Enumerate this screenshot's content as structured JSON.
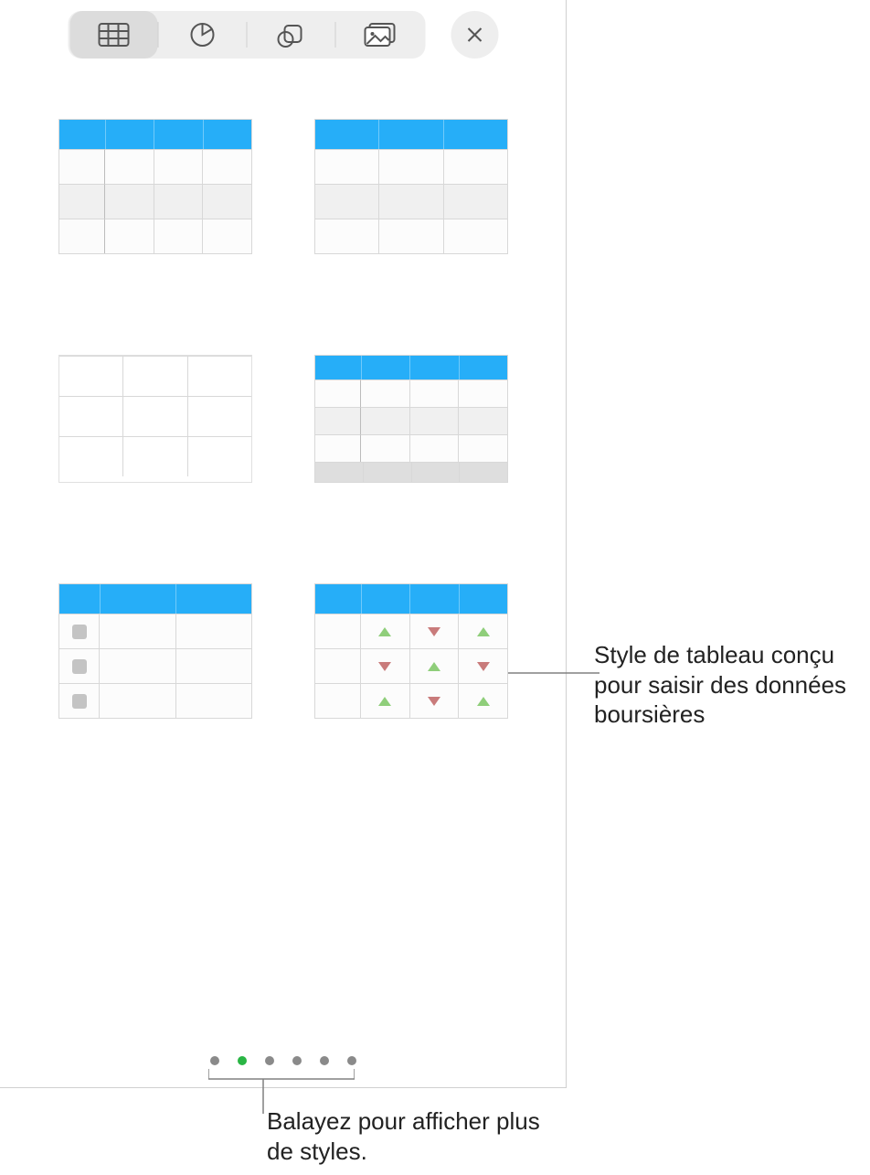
{
  "toolbar": {
    "tabs": [
      "table-icon",
      "chart-icon",
      "shape-icon",
      "media-icon"
    ],
    "active_tab_index": 0
  },
  "page_dots": {
    "count": 6,
    "active_index": 1
  },
  "callouts": {
    "stock_table": "Style de tableau conçu pour saisir des données boursières",
    "page_dots": "Balayez pour afficher plus de styles."
  },
  "colors": {
    "accent_blue": "#26aef8",
    "dot_active": "#29b544"
  }
}
